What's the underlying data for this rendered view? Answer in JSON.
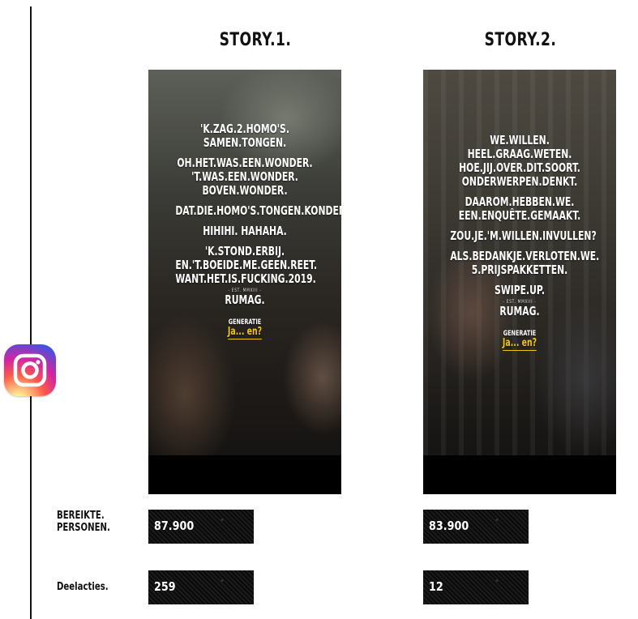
{
  "stories": [
    {
      "title": "STORY.1.",
      "lines": [
        "'K.ZAG.2.HOMO'S.\nSAMEN.TONGEN.",
        "OH.HET.WAS.EEN.WONDER.\n'T.WAS.EEN.WONDER.\nBOVEN.WONDER.",
        "DAT.DIE.HOMO'S.TONGEN.KONDEN.",
        "HIHIHI. HAHAHA.",
        "'K.STOND.ERBIJ.\nEN.'T.BOEIDE.ME.GEEN.REET.\nWANT.HET.IS.FUCKING.2019."
      ],
      "est": "- EST. MMXIII -",
      "brand": "RUMAG.",
      "gen_top": "GENERATIE",
      "gen_bottom": "Ja... en?"
    },
    {
      "title": "STORY.2.",
      "lines": [
        "WE.WILLEN.\nHEEL.GRAAG.WETEN.\nHOE.JIJ.OVER.DIT.SOORT.\nONDERWERPEN.DENKT.",
        "DAAROM.HEBBEN.WE.\nEEN.ENQUÊTE.GEMAAKT.",
        "ZOU.JE.'M.WILLEN.INVULLEN?",
        "ALS.BEDANKJE.VERLOTEN.WE.\n5.PRIJSPAKKETTEN.",
        "SWIPE.UP."
      ],
      "est": "- EST. MMXIII -",
      "brand": "RUMAG.",
      "gen_top": "GENERATIE",
      "gen_bottom": "Ja... en?"
    }
  ],
  "labels": {
    "reach": "BEREIKTE.\nPERSONEN.",
    "shares": "Deelacties."
  },
  "stats": {
    "story1_reach": "87.900",
    "story2_reach": "83.900",
    "story1_shares": "259",
    "story2_shares": "12"
  },
  "icon": "instagram-icon",
  "colors": {
    "accent_yellow": "#f3c614",
    "background": "#ffffff",
    "text": "#111111"
  }
}
